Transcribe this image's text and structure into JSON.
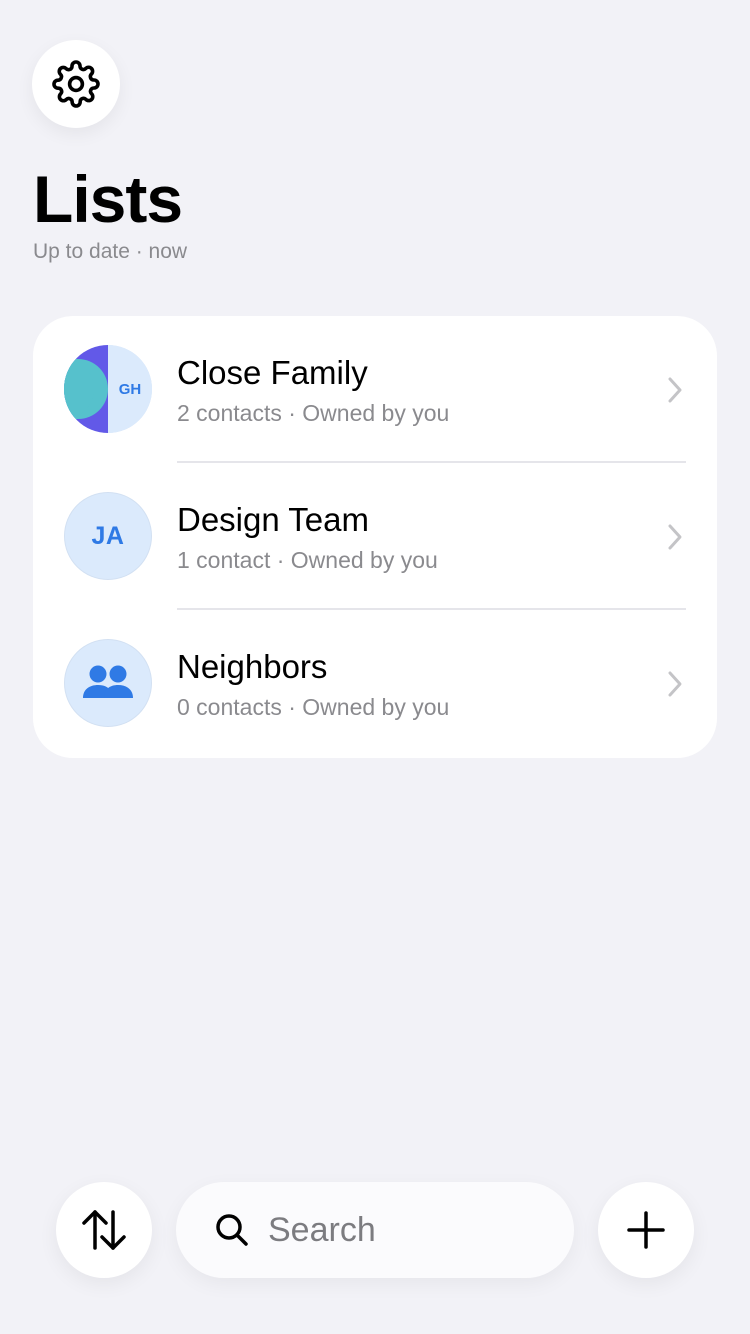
{
  "header": {
    "title": "Lists",
    "status": "Up to date · now"
  },
  "lists": [
    {
      "title": "Close Family",
      "subtitle": "2 contacts · Owned by you",
      "avatar_initials": "GH"
    },
    {
      "title": "Design Team",
      "subtitle": "1 contact · Owned by you",
      "avatar_initials": "JA"
    },
    {
      "title": "Neighbors",
      "subtitle": "0 contacts · Owned by you",
      "avatar_icon": "people-icon"
    }
  ],
  "search": {
    "placeholder": "Search",
    "icon": "search-icon"
  },
  "toolbar": {
    "settings_icon": "gear-icon",
    "sort_icon": "sort-arrows-icon",
    "add_icon": "plus-icon"
  },
  "colors": {
    "accent": "#2f7ae5",
    "background": "#f2f2f7",
    "avatar_bg": "#dbeafc",
    "avatar_purple": "#6259e8",
    "avatar_teal": "#56c1cc"
  }
}
